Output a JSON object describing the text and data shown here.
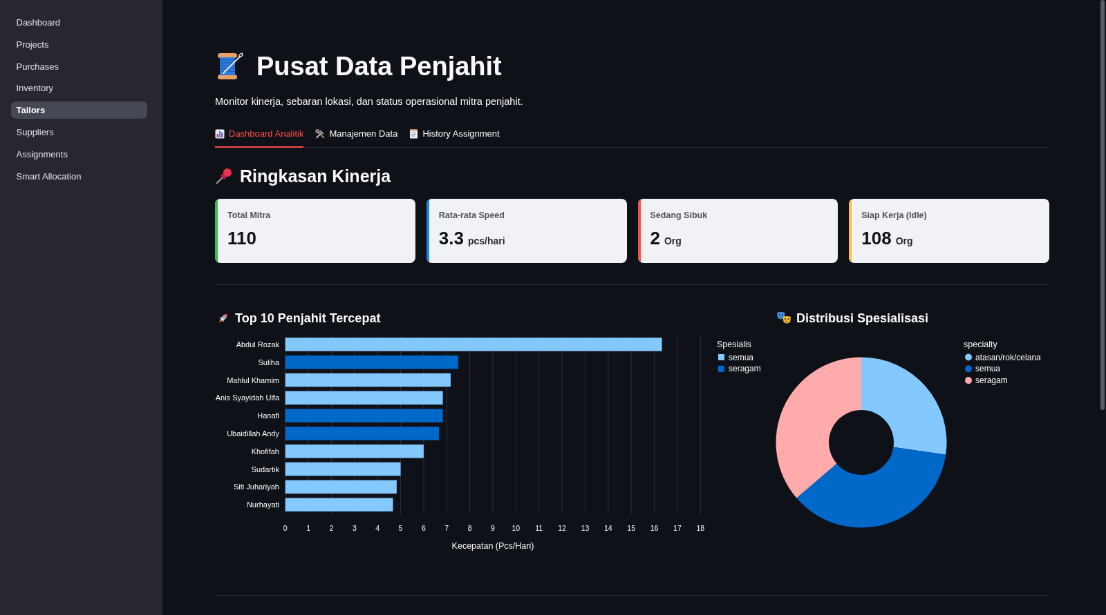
{
  "sidebar": {
    "items": [
      {
        "label": "Dashboard",
        "selected": false
      },
      {
        "label": "Projects",
        "selected": false
      },
      {
        "label": "Purchases",
        "selected": false
      },
      {
        "label": "Inventory",
        "selected": false
      },
      {
        "label": "Tailors",
        "selected": true
      },
      {
        "label": "Suppliers",
        "selected": false
      },
      {
        "label": "Assignments",
        "selected": false
      },
      {
        "label": "Smart Allocation",
        "selected": false
      }
    ]
  },
  "header": {
    "title": "Pusat Data Penjahit",
    "subtitle": "Monitor kinerja, sebaran lokasi, dan status operasional mitra penjahit."
  },
  "tabs": [
    {
      "label": "Dashboard Analitik",
      "selected": true
    },
    {
      "label": "Manajemen Data",
      "selected": false
    },
    {
      "label": "History Assignment",
      "selected": false
    }
  ],
  "summary": {
    "heading": "Ringkasan Kinerja",
    "metrics": [
      {
        "label": "Total Mitra",
        "value": "110",
        "color": "#3fb950"
      },
      {
        "label": "Rata-rata Speed",
        "value": "3.3",
        "unit": "pcs/hari",
        "color": "#1c83e1"
      },
      {
        "label": "Sedang Sibuk",
        "value": "2",
        "unit": "Org",
        "color": "#ff4b4b"
      },
      {
        "label": "Siap Kerja (Idle)",
        "value": "108",
        "unit": "Org",
        "color": "#ffbd45"
      }
    ]
  },
  "top_tailors": {
    "heading": "Top 10 Penjahit Tercepat",
    "legend_title": "Spesialis",
    "chart_data": {
      "type": "bar",
      "orientation": "horizontal",
      "xlabel": "Kecepatan (Pcs/Hari)",
      "categories": [
        "Abdul Rozak",
        "Suliha",
        "Mahlul Khamim",
        "Anis Syayidah Ulfa",
        "Hanafi",
        "Ubaidillah Andy",
        "Khofifah",
        "Sudartik",
        "Siti Juhariyah",
        "Nurhayati"
      ],
      "series": [
        {
          "name": "semua",
          "color": "#83c9ff",
          "values": [
            16.33,
            null,
            7.17,
            6.83,
            null,
            null,
            6.0,
            5.0,
            4.83,
            4.67
          ]
        },
        {
          "name": "seragam",
          "color": "#0068c9",
          "values": [
            null,
            7.5,
            null,
            null,
            6.83,
            6.67,
            null,
            null,
            null,
            null
          ]
        }
      ],
      "xlim": [
        0,
        18
      ],
      "xticks": [
        0,
        1,
        2,
        3,
        4,
        5,
        6,
        7,
        8,
        9,
        10,
        11,
        12,
        13,
        14,
        15,
        16,
        17,
        18
      ],
      "grid": true,
      "legend": "right"
    }
  },
  "specialty_distribution": {
    "heading": "Distribusi Spesialisasi",
    "legend_title": "specialty",
    "chart_data": {
      "type": "donut",
      "categories": [
        "atasan/rok/celana",
        "semua",
        "seragam"
      ],
      "values": [
        27.3,
        36.4,
        36.3
      ],
      "colors": [
        "#83c9ff",
        "#0068c9",
        "#ffabab"
      ],
      "legend": "right"
    }
  }
}
